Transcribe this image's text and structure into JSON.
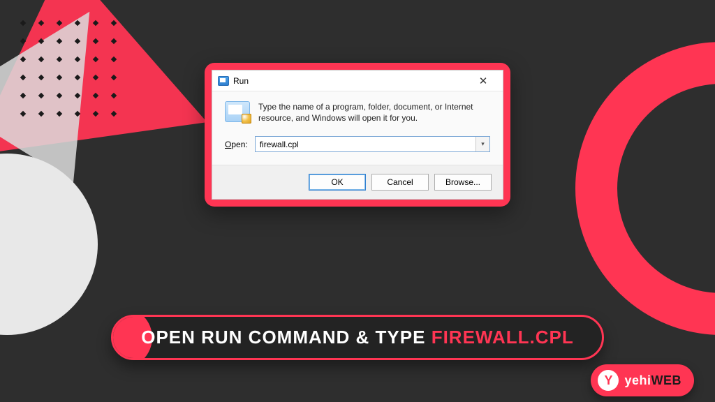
{
  "dialog": {
    "title": "Run",
    "prompt": "Type the name of a program, folder, document, or Internet resource, and Windows will open it for you.",
    "open_label": "Open:",
    "open_value": "firewall.cpl",
    "buttons": {
      "ok": "OK",
      "cancel": "Cancel",
      "browse": "Browse..."
    },
    "close_glyph": "✕"
  },
  "caption": {
    "prefix": "OPEN RUN COMMAND & TYPE ",
    "highlight": "FIREWALL.CPL"
  },
  "brand": {
    "badge_letter": "Y",
    "name_main": "yehi",
    "name_sub": "WEB"
  },
  "colors": {
    "accent": "#ff3553",
    "bg": "#2e2e2e"
  }
}
